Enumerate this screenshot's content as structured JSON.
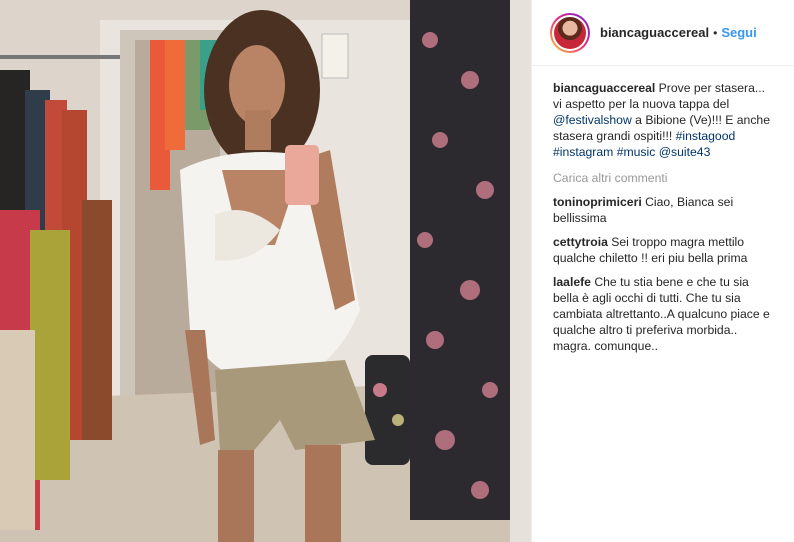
{
  "header": {
    "username": "biancaguaccereal",
    "separator": "•",
    "follow_label": "Segui"
  },
  "caption": {
    "username": "biancaguaccereal",
    "text_1": " Prove per stasera... vi aspetto per la nuova tappa del ",
    "mention_1": "@festivalshow",
    "text_2": " a Bibione (Ve)!!! E anche stasera grandi ospiti!!! ",
    "hashtag_1": "#instagood",
    "hashtag_2": "#instagram",
    "hashtag_3": "#music",
    "mention_2": "@suite43"
  },
  "load_more_label": "Carica altri commenti",
  "comments": [
    {
      "username": "toninoprimiceri",
      "text": " Ciao, Bianca sei bellissima"
    },
    {
      "username": "cettytroia",
      "text": " Sei troppo magra mettilo qualche chiletto !! eri piu bella prima"
    },
    {
      "username": "laalefe",
      "text": " Che tu stia bene e che tu sia bella è agli occhi di tutti. Che tu sia cambiata altrettanto..A qualcuno piace e qualche altro ti preferiva morbida.. magra. comunque.."
    }
  ],
  "colors": {
    "link": "#003569",
    "follow": "#3897f0",
    "muted": "#999999"
  }
}
